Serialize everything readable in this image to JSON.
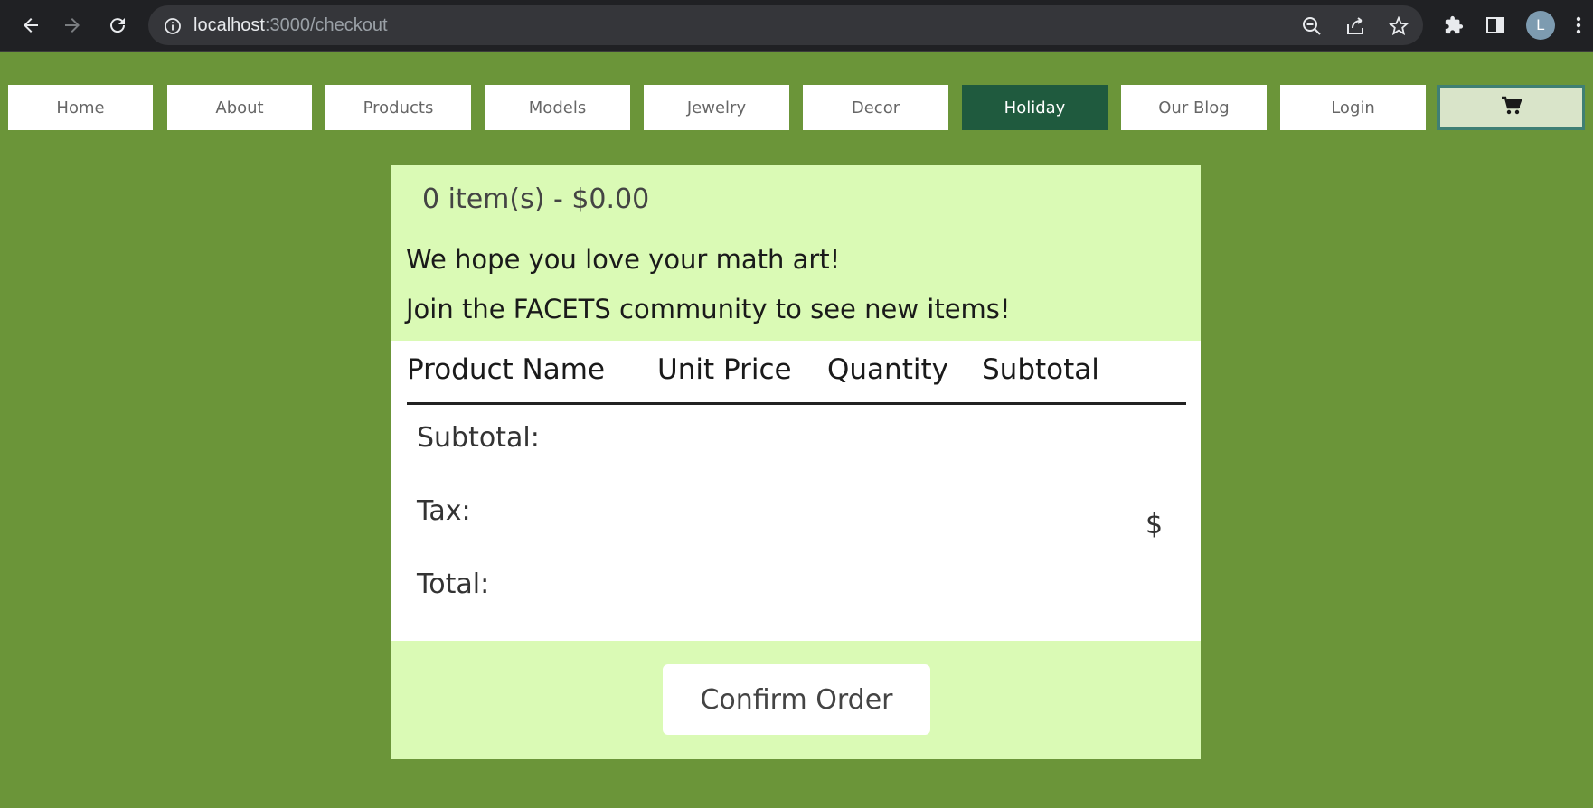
{
  "browser": {
    "url_host": "localhost",
    "url_path": ":3000/checkout",
    "avatar_letter": "L",
    "icons": [
      "back-icon",
      "forward-icon",
      "reload-icon",
      "info-icon",
      "zoom-out-icon",
      "share-icon",
      "star-icon",
      "extensions-icon",
      "side-panel-icon",
      "menu-icon"
    ]
  },
  "nav": {
    "items": [
      {
        "label": "Home"
      },
      {
        "label": "About"
      },
      {
        "label": "Products"
      },
      {
        "label": "Models"
      },
      {
        "label": "Jewelry"
      },
      {
        "label": "Decor"
      },
      {
        "label": "Holiday"
      },
      {
        "label": "Our Blog"
      },
      {
        "label": "Login"
      }
    ],
    "cart_icon": "cart-icon"
  },
  "checkout": {
    "cart_summary": "0 item(s) - $0.00",
    "message_1": "We hope you love your math art!",
    "message_2": "Join the FACETS community to see new items!",
    "columns": [
      "Product Name",
      "Unit Price",
      "Quantity",
      "Subtotal"
    ],
    "subtotal_label": "Subtotal:",
    "tax_label": "Tax:",
    "total_label": "Total:",
    "currency_symbol": "$",
    "confirm_label": "Confirm Order"
  },
  "colors": {
    "page_bg": "#6b9539",
    "panel_bg": "#dafab5",
    "active_nav": "#1f5a3e",
    "cart_nav_bg": "#d9e4c9"
  }
}
